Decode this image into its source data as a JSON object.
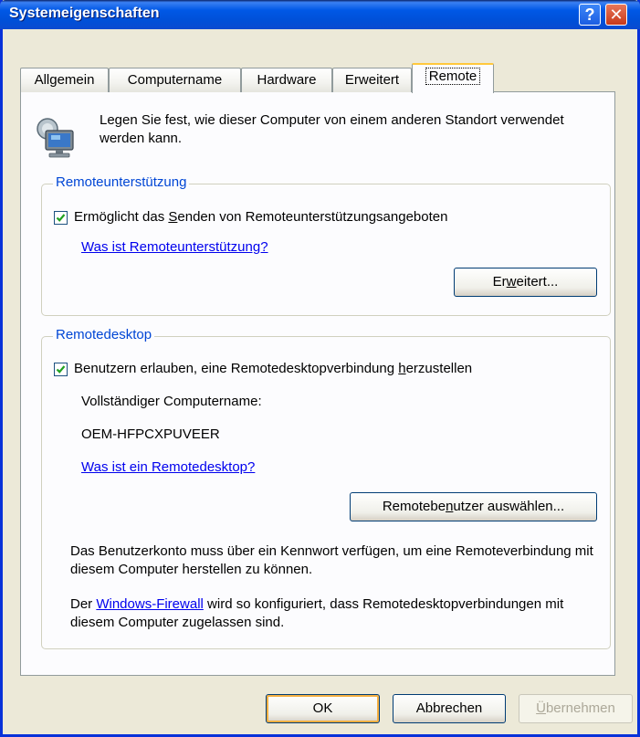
{
  "window": {
    "title": "Systemeigenschaften"
  },
  "titlebar": {
    "help_label": "?",
    "close_label": "✕"
  },
  "tabs": [
    {
      "label": "Allgemein",
      "active": false
    },
    {
      "label": "Computername",
      "active": false
    },
    {
      "label": "Hardware",
      "active": false
    },
    {
      "label": "Erweitert",
      "active": false
    },
    {
      "label": "Remote",
      "active": true
    }
  ],
  "intro": {
    "text": "Legen Sie fest, wie dieser Computer von einem anderen Standort verwendet werden kann."
  },
  "remote_assistance": {
    "group_title": "Remoteunterstützung",
    "checkbox_checked": true,
    "checkbox_label_before": "Ermöglicht das ",
    "checkbox_label_accel": "S",
    "checkbox_label_after": "enden von Remoteunterstützungsangeboten",
    "help_link": "Was ist Remoteunterstützung?",
    "advanced_before": "Er",
    "advanced_accel": "w",
    "advanced_after": "eitert..."
  },
  "remote_desktop": {
    "group_title": "Remotedesktop",
    "checkbox_checked": true,
    "checkbox_label_before": "Benutzern erlauben, eine Remotedesktopverbindung ",
    "checkbox_label_accel": "h",
    "checkbox_label_after": "erzustellen",
    "computer_name_label": "Vollständiger Computername:",
    "computer_name_value": "OEM-HFPCXPUVEER",
    "help_link": "Was ist ein Remotedesktop?",
    "select_users_before": "Remotebe",
    "select_users_accel": "n",
    "select_users_after": "utzer auswählen...",
    "password_note": "Das Benutzerkonto muss über ein Kennwort verfügen, um eine Remoteverbindung mit diesem Computer herstellen zu können.",
    "firewall_before": "Der ",
    "firewall_link": "Windows-Firewall",
    "firewall_after": " wird so konfiguriert, dass Remotedesktopverbindungen mit diesem Computer zugelassen sind."
  },
  "buttons": {
    "ok": "OK",
    "cancel": "Abbrechen",
    "apply_accel": "Ü",
    "apply_rest": "bernehmen"
  },
  "colors": {
    "titlebar": "#0058e6",
    "group_title": "#0046d5",
    "link": "#0000ee",
    "face": "#ece9d8"
  }
}
